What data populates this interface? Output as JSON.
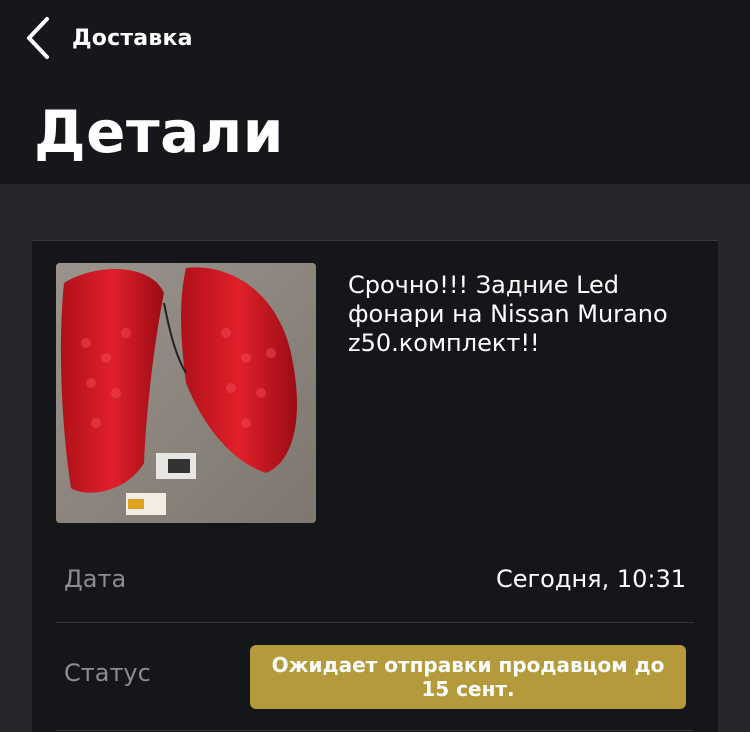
{
  "header": {
    "back_label": "Доставка",
    "title": "Детали"
  },
  "product": {
    "title": "Срочно!!! Задние Led фонари на Nissan Murano z50.комплект!!"
  },
  "details": {
    "date_label": "Дата",
    "date_value": "Сегодня, 10:31",
    "status_label": "Статус",
    "status_value": "Ожидает отправки продавцом до 15 сент."
  },
  "colors": {
    "header_bg": "#16171b",
    "page_bg": "#25262b",
    "card_bg": "#15161a",
    "status_badge": "#b59a3b",
    "muted_text": "#8c8d93"
  },
  "icons": {
    "back": "chevron-left-icon"
  }
}
